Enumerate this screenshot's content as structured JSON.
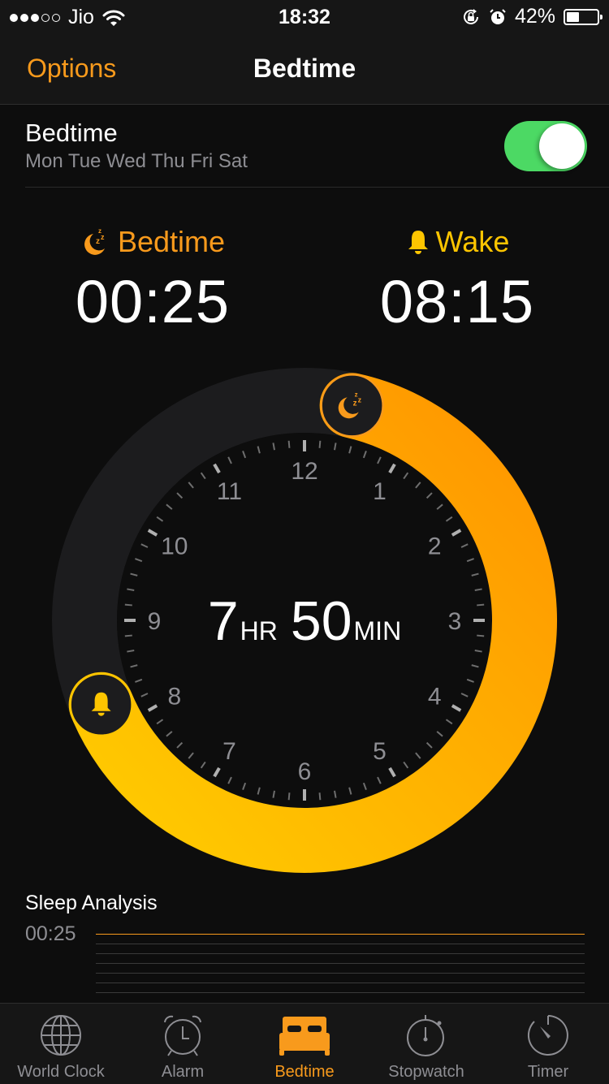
{
  "status_bar": {
    "carrier": "Jio",
    "signal_bars_filled": 3,
    "signal_bars_total": 5,
    "time": "18:32",
    "battery_percent_label": "42%",
    "battery_level": 0.42,
    "icons": [
      "signal-dots",
      "wifi-icon",
      "rotation-lock-icon",
      "alarm-clock-icon",
      "battery-icon"
    ]
  },
  "nav": {
    "left_button": "Options",
    "title": "Bedtime"
  },
  "bedtime_toggle": {
    "title": "Bedtime",
    "days": "Mon Tue Wed Thu Fri Sat",
    "enabled": true
  },
  "schedule": {
    "bedtime_label": "Bedtime",
    "bedtime_value": "00:25",
    "wake_label": "Wake",
    "wake_value": "08:15"
  },
  "dial": {
    "hours_value": "7",
    "hours_unit": "HR",
    "minutes_value": "50",
    "minutes_unit": "MIN",
    "hour_numbers": [
      "12",
      "1",
      "2",
      "3",
      "4",
      "5",
      "6",
      "7",
      "8",
      "9",
      "10",
      "11"
    ],
    "bedtime_hours": 0.4167,
    "wake_hours": 8.25
  },
  "colors": {
    "accent": "#f89a1c",
    "wake_yellow": "#fdc500",
    "ring_start": "#ffcc00",
    "ring_end": "#ff9500",
    "switch_on": "#4cd964"
  },
  "sleep_analysis": {
    "title": "Sleep Analysis",
    "first_time": "00:25"
  },
  "tabs": [
    {
      "label": "World Clock",
      "icon": "globe-icon",
      "active": false
    },
    {
      "label": "Alarm",
      "icon": "alarm-clock-icon",
      "active": false
    },
    {
      "label": "Bedtime",
      "icon": "bed-icon",
      "active": true
    },
    {
      "label": "Stopwatch",
      "icon": "stopwatch-icon",
      "active": false
    },
    {
      "label": "Timer",
      "icon": "timer-icon",
      "active": false
    }
  ]
}
